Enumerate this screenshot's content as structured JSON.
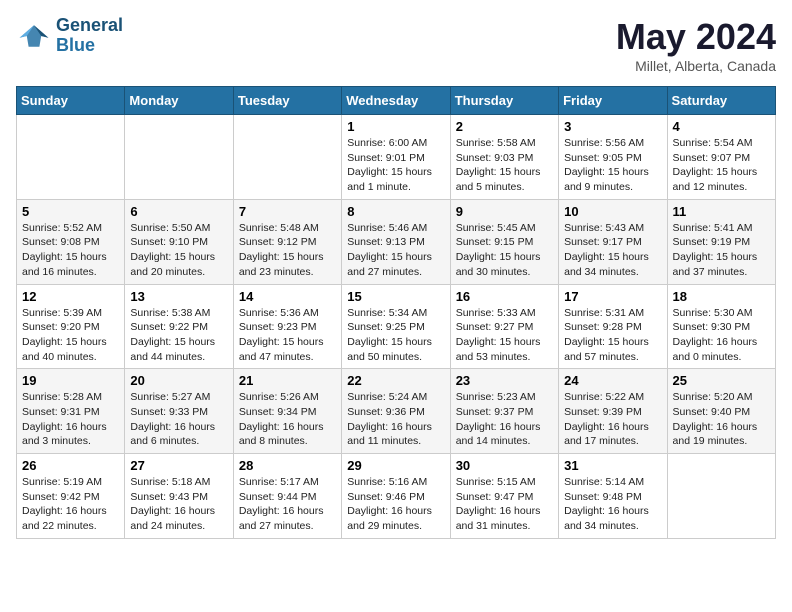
{
  "header": {
    "logo_line1": "General",
    "logo_line2": "Blue",
    "month": "May 2024",
    "location": "Millet, Alberta, Canada"
  },
  "days_of_week": [
    "Sunday",
    "Monday",
    "Tuesday",
    "Wednesday",
    "Thursday",
    "Friday",
    "Saturday"
  ],
  "weeks": [
    [
      {
        "day": "",
        "content": ""
      },
      {
        "day": "",
        "content": ""
      },
      {
        "day": "",
        "content": ""
      },
      {
        "day": "1",
        "content": "Sunrise: 6:00 AM\nSunset: 9:01 PM\nDaylight: 15 hours\nand 1 minute."
      },
      {
        "day": "2",
        "content": "Sunrise: 5:58 AM\nSunset: 9:03 PM\nDaylight: 15 hours\nand 5 minutes."
      },
      {
        "day": "3",
        "content": "Sunrise: 5:56 AM\nSunset: 9:05 PM\nDaylight: 15 hours\nand 9 minutes."
      },
      {
        "day": "4",
        "content": "Sunrise: 5:54 AM\nSunset: 9:07 PM\nDaylight: 15 hours\nand 12 minutes."
      }
    ],
    [
      {
        "day": "5",
        "content": "Sunrise: 5:52 AM\nSunset: 9:08 PM\nDaylight: 15 hours\nand 16 minutes."
      },
      {
        "day": "6",
        "content": "Sunrise: 5:50 AM\nSunset: 9:10 PM\nDaylight: 15 hours\nand 20 minutes."
      },
      {
        "day": "7",
        "content": "Sunrise: 5:48 AM\nSunset: 9:12 PM\nDaylight: 15 hours\nand 23 minutes."
      },
      {
        "day": "8",
        "content": "Sunrise: 5:46 AM\nSunset: 9:13 PM\nDaylight: 15 hours\nand 27 minutes."
      },
      {
        "day": "9",
        "content": "Sunrise: 5:45 AM\nSunset: 9:15 PM\nDaylight: 15 hours\nand 30 minutes."
      },
      {
        "day": "10",
        "content": "Sunrise: 5:43 AM\nSunset: 9:17 PM\nDaylight: 15 hours\nand 34 minutes."
      },
      {
        "day": "11",
        "content": "Sunrise: 5:41 AM\nSunset: 9:19 PM\nDaylight: 15 hours\nand 37 minutes."
      }
    ],
    [
      {
        "day": "12",
        "content": "Sunrise: 5:39 AM\nSunset: 9:20 PM\nDaylight: 15 hours\nand 40 minutes."
      },
      {
        "day": "13",
        "content": "Sunrise: 5:38 AM\nSunset: 9:22 PM\nDaylight: 15 hours\nand 44 minutes."
      },
      {
        "day": "14",
        "content": "Sunrise: 5:36 AM\nSunset: 9:23 PM\nDaylight: 15 hours\nand 47 minutes."
      },
      {
        "day": "15",
        "content": "Sunrise: 5:34 AM\nSunset: 9:25 PM\nDaylight: 15 hours\nand 50 minutes."
      },
      {
        "day": "16",
        "content": "Sunrise: 5:33 AM\nSunset: 9:27 PM\nDaylight: 15 hours\nand 53 minutes."
      },
      {
        "day": "17",
        "content": "Sunrise: 5:31 AM\nSunset: 9:28 PM\nDaylight: 15 hours\nand 57 minutes."
      },
      {
        "day": "18",
        "content": "Sunrise: 5:30 AM\nSunset: 9:30 PM\nDaylight: 16 hours\nand 0 minutes."
      }
    ],
    [
      {
        "day": "19",
        "content": "Sunrise: 5:28 AM\nSunset: 9:31 PM\nDaylight: 16 hours\nand 3 minutes."
      },
      {
        "day": "20",
        "content": "Sunrise: 5:27 AM\nSunset: 9:33 PM\nDaylight: 16 hours\nand 6 minutes."
      },
      {
        "day": "21",
        "content": "Sunrise: 5:26 AM\nSunset: 9:34 PM\nDaylight: 16 hours\nand 8 minutes."
      },
      {
        "day": "22",
        "content": "Sunrise: 5:24 AM\nSunset: 9:36 PM\nDaylight: 16 hours\nand 11 minutes."
      },
      {
        "day": "23",
        "content": "Sunrise: 5:23 AM\nSunset: 9:37 PM\nDaylight: 16 hours\nand 14 minutes."
      },
      {
        "day": "24",
        "content": "Sunrise: 5:22 AM\nSunset: 9:39 PM\nDaylight: 16 hours\nand 17 minutes."
      },
      {
        "day": "25",
        "content": "Sunrise: 5:20 AM\nSunset: 9:40 PM\nDaylight: 16 hours\nand 19 minutes."
      }
    ],
    [
      {
        "day": "26",
        "content": "Sunrise: 5:19 AM\nSunset: 9:42 PM\nDaylight: 16 hours\nand 22 minutes."
      },
      {
        "day": "27",
        "content": "Sunrise: 5:18 AM\nSunset: 9:43 PM\nDaylight: 16 hours\nand 24 minutes."
      },
      {
        "day": "28",
        "content": "Sunrise: 5:17 AM\nSunset: 9:44 PM\nDaylight: 16 hours\nand 27 minutes."
      },
      {
        "day": "29",
        "content": "Sunrise: 5:16 AM\nSunset: 9:46 PM\nDaylight: 16 hours\nand 29 minutes."
      },
      {
        "day": "30",
        "content": "Sunrise: 5:15 AM\nSunset: 9:47 PM\nDaylight: 16 hours\nand 31 minutes."
      },
      {
        "day": "31",
        "content": "Sunrise: 5:14 AM\nSunset: 9:48 PM\nDaylight: 16 hours\nand 34 minutes."
      },
      {
        "day": "",
        "content": ""
      }
    ]
  ]
}
